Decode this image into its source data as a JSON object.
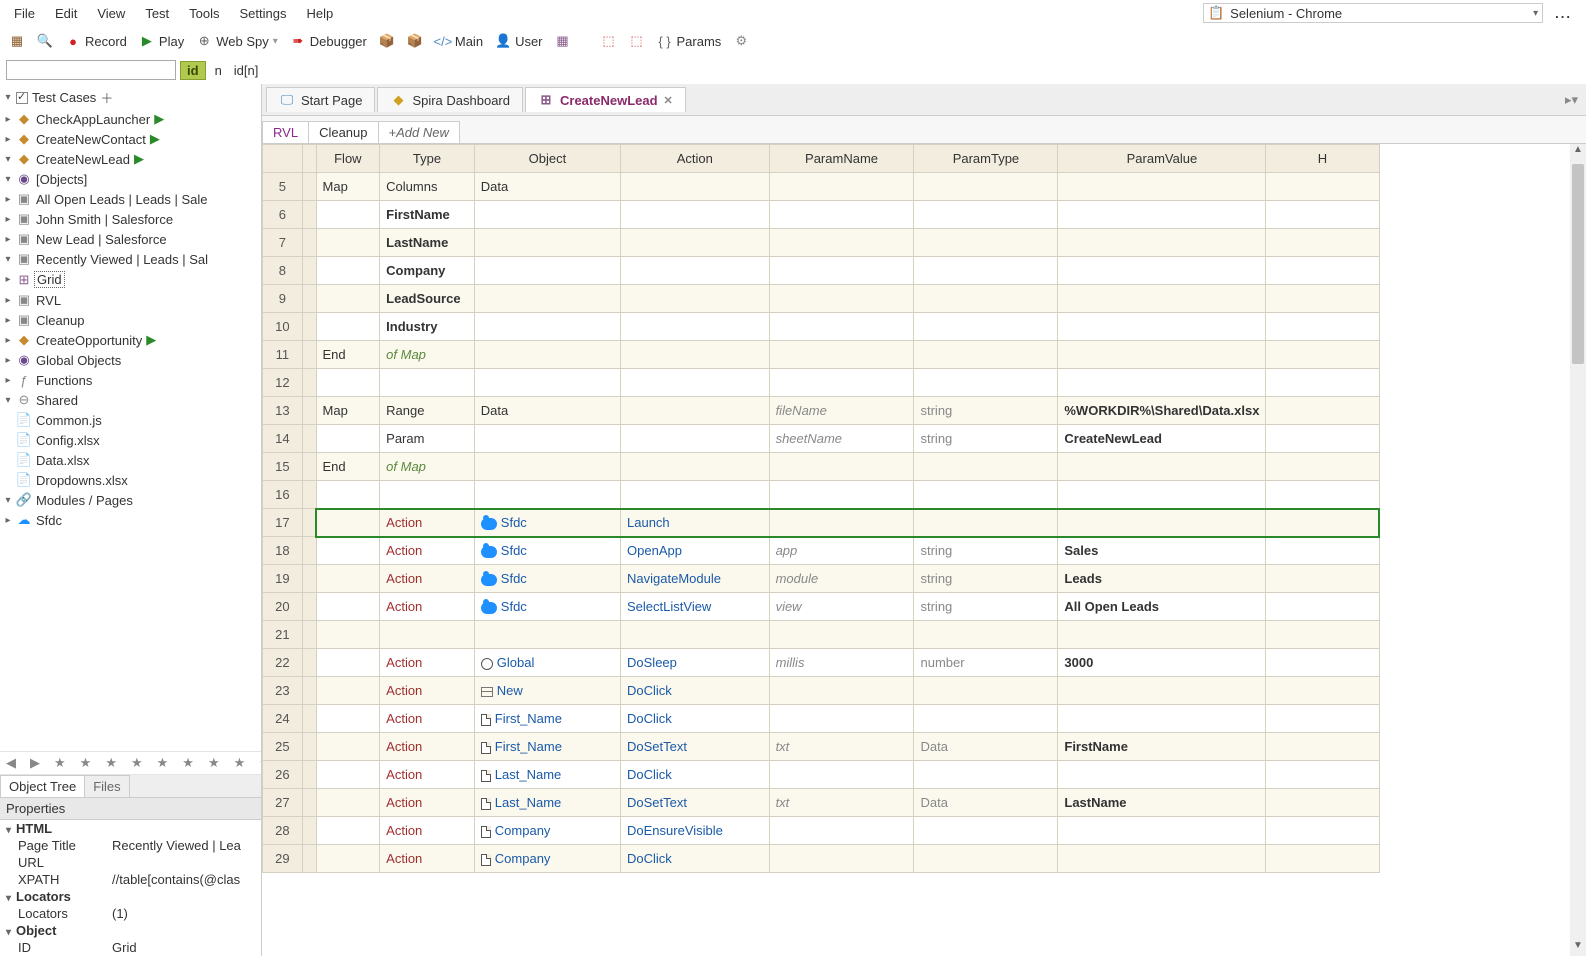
{
  "menubar": [
    "File",
    "Edit",
    "View",
    "Test",
    "Tools",
    "Settings",
    "Help"
  ],
  "browser_select": "Selenium - Chrome",
  "toolbar": {
    "record": "Record",
    "play": "Play",
    "webspy": "Web Spy",
    "debugger": "Debugger",
    "main": "Main",
    "user": "User",
    "params": "Params"
  },
  "filter": {
    "id": "id",
    "n": "n",
    "idn": "id[n]"
  },
  "tree": {
    "root": "Test Cases",
    "items": [
      "CheckAppLauncher",
      "CreateNewContact",
      "CreateNewLead",
      "[Objects]",
      "All Open Leads | Leads | Sale",
      "John Smith | Salesforce",
      "New Lead | Salesforce",
      "Recently Viewed | Leads | Sal",
      "Grid",
      "RVL",
      "Cleanup",
      "CreateOpportunity",
      "Global Objects",
      "Functions",
      "Shared",
      "Common.js",
      "Config.xlsx",
      "Data.xlsx",
      "Dropdowns.xlsx",
      "Modules / Pages",
      "Sfdc"
    ]
  },
  "panel_tabs": {
    "object_tree": "Object Tree",
    "files": "Files"
  },
  "properties_label": "Properties",
  "props": {
    "html_group": "HTML",
    "page_title_k": "Page Title",
    "page_title_v": "Recently Viewed | Lea",
    "url_k": "URL",
    "url_v": "",
    "xpath_k": "XPATH",
    "xpath_v": "//table[contains(@clas",
    "locators_group": "Locators",
    "locators_k": "Locators",
    "locators_v": "(1)",
    "object_group": "Object",
    "id_k": "ID",
    "id_v": "Grid"
  },
  "doc_tabs": {
    "start": "Start Page",
    "spira": "Spira Dashboard",
    "active": "CreateNewLead"
  },
  "sheet_tabs": {
    "rvl": "RVL",
    "cleanup": "Cleanup",
    "add": "+Add New"
  },
  "columns": [
    "Flow",
    "Type",
    "Object",
    "Action",
    "ParamName",
    "ParamType",
    "ParamValue",
    "H"
  ],
  "rows": [
    {
      "n": 5,
      "flow": "Map",
      "type": "Columns",
      "obj": "Data"
    },
    {
      "n": 6,
      "type": "FirstName",
      "bold": true
    },
    {
      "n": 7,
      "type": "LastName",
      "bold": true
    },
    {
      "n": 8,
      "type": "Company",
      "bold": true
    },
    {
      "n": 9,
      "type": "LeadSource",
      "bold": true
    },
    {
      "n": 10,
      "type": "Industry",
      "bold": true
    },
    {
      "n": 11,
      "flow": "End",
      "type": "of Map",
      "type_style": "flow-end"
    },
    {
      "n": 12
    },
    {
      "n": 13,
      "flow": "Map",
      "type": "Range",
      "obj": "Data",
      "pn": "fileName",
      "pn_italic": true,
      "pt": "string",
      "pv": "%WORKDIR%\\Shared\\Data.xlsx",
      "pv_bold": true
    },
    {
      "n": 14,
      "type": "Param",
      "pn": "sheetName",
      "pn_italic": true,
      "pt": "string",
      "pv": "CreateNewLead",
      "pv_bold": true
    },
    {
      "n": 15,
      "flow": "End",
      "type": "of Map",
      "type_style": "flow-end"
    },
    {
      "n": 16
    },
    {
      "n": 17,
      "type": "Action",
      "type_style": "type-action",
      "obj": "Sfdc",
      "obj_icon": "sfdc",
      "act": "Launch",
      "hl": true,
      "arrow": true
    },
    {
      "n": 18,
      "type": "Action",
      "type_style": "type-action",
      "obj": "Sfdc",
      "obj_icon": "sfdc",
      "act": "OpenApp",
      "pn": "app",
      "pn_italic": true,
      "pt": "string",
      "pv": "Sales",
      "pv_bold": true
    },
    {
      "n": 19,
      "type": "Action",
      "type_style": "type-action",
      "obj": "Sfdc",
      "obj_icon": "sfdc",
      "act": "NavigateModule",
      "pn": "module",
      "pn_italic": true,
      "pt": "string",
      "pv": "Leads",
      "pv_bold": true
    },
    {
      "n": 20,
      "type": "Action",
      "type_style": "type-action",
      "obj": "Sfdc",
      "obj_icon": "sfdc",
      "act": "SelectListView",
      "pn": "view",
      "pn_italic": true,
      "pt": "string",
      "pv": "All Open Leads",
      "pv_bold": true
    },
    {
      "n": 21
    },
    {
      "n": 22,
      "type": "Action",
      "type_style": "type-action",
      "obj": "Global",
      "obj_icon": "globe",
      "act": "DoSleep",
      "pn": "millis",
      "pn_italic": true,
      "pt": "number",
      "pv": "3000",
      "pv_bold": true
    },
    {
      "n": 23,
      "type": "Action",
      "type_style": "type-action",
      "obj": "New",
      "obj_icon": "box",
      "act": "DoClick"
    },
    {
      "n": 24,
      "type": "Action",
      "type_style": "type-action",
      "obj": "First_Name",
      "obj_icon": "doc",
      "act": "DoClick"
    },
    {
      "n": 25,
      "type": "Action",
      "type_style": "type-action",
      "obj": "First_Name",
      "obj_icon": "doc",
      "act": "DoSetText",
      "pn": "txt",
      "pn_italic": true,
      "pt": "Data",
      "pv": "FirstName",
      "pv_bold": true
    },
    {
      "n": 26,
      "type": "Action",
      "type_style": "type-action",
      "obj": "Last_Name",
      "obj_icon": "doc",
      "act": "DoClick"
    },
    {
      "n": 27,
      "type": "Action",
      "type_style": "type-action",
      "obj": "Last_Name",
      "obj_icon": "doc",
      "act": "DoSetText",
      "pn": "txt",
      "pn_italic": true,
      "pt": "Data",
      "pv": "LastName",
      "pv_bold": true
    },
    {
      "n": 28,
      "type": "Action",
      "type_style": "type-action",
      "obj": "Company",
      "obj_icon": "doc",
      "act": "DoEnsureVisible"
    },
    {
      "n": 29,
      "type": "Action",
      "type_style": "type-action",
      "obj": "Company",
      "obj_icon": "doc",
      "act": "DoClick"
    }
  ]
}
